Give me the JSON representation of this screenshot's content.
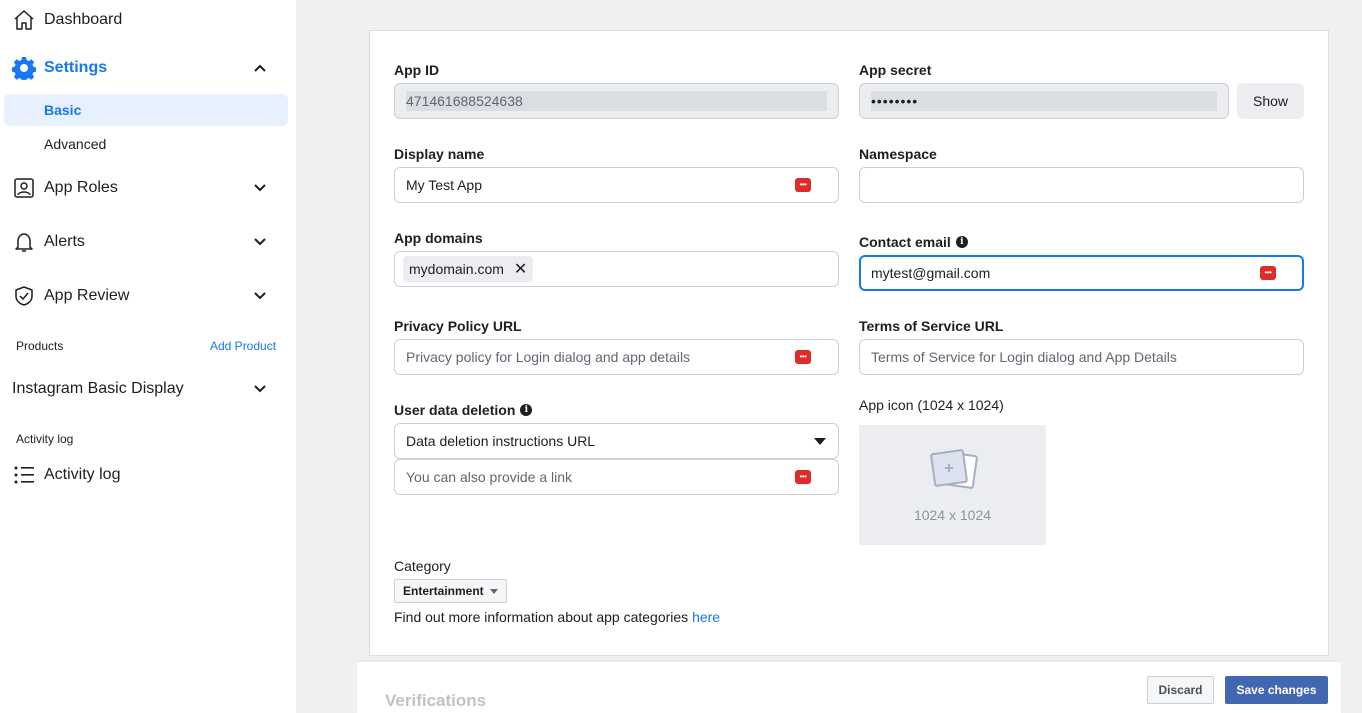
{
  "sidebar": {
    "dashboard": "Dashboard",
    "settings": "Settings",
    "basic": "Basic",
    "advanced": "Advanced",
    "app_roles": "App Roles",
    "alerts": "Alerts",
    "app_review": "App Review",
    "products_label": "Products",
    "add_product": "Add Product",
    "instagram": "Instagram Basic Display",
    "activity_section": "Activity log",
    "activity_log": "Activity log",
    "accent_color": "#1877f2"
  },
  "form": {
    "app_id_label": "App ID",
    "app_id_value": "471461688524638",
    "app_secret_label": "App secret",
    "app_secret_value": "••••••••",
    "show_label": "Show",
    "display_name_label": "Display name",
    "display_name_value": "My Test App",
    "namespace_label": "Namespace",
    "namespace_value": "",
    "app_domains_label": "App domains",
    "domain_chip": "mydomain.com",
    "contact_email_label": "Contact email",
    "contact_email_value": "mytest@gmail.com",
    "privacy_label": "Privacy Policy URL",
    "privacy_placeholder": "Privacy policy for Login dialog and app details",
    "tos_label": "Terms of Service URL",
    "tos_placeholder": "Terms of Service for Login dialog and App Details",
    "user_data_label": "User data deletion",
    "user_data_select": "Data deletion instructions URL",
    "user_data_link_placeholder": "You can also provide a link",
    "app_icon_label": "App icon (1024 x 1024)",
    "app_icon_size": "1024 x 1024",
    "category_label": "Category",
    "category_value": "Entertainment",
    "category_info": "Find out more information about app categories ",
    "category_link": "here"
  },
  "footer": {
    "verifications": "Verifications",
    "discard": "Discard",
    "save": "Save changes",
    "save_color": "#4267b2"
  }
}
